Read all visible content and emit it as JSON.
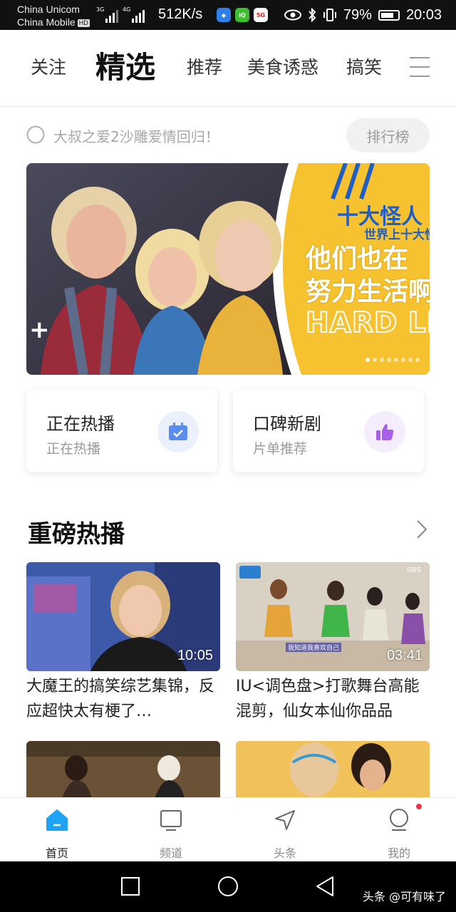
{
  "status_bar": {
    "carrier1": "China Unicom",
    "carrier2": "China Mobile",
    "hd_badge": "HD",
    "net1": "3G",
    "net2": "4G",
    "speed": "512K/s",
    "battery": "79%",
    "time": "20:03",
    "icons": [
      "shield-app-icon",
      "iqiyi-app-icon",
      "5g-app-icon",
      "eye-icon",
      "bluetooth-icon",
      "vibrate-icon",
      "battery-icon"
    ]
  },
  "tabs": [
    "关注",
    "精选",
    "推荐",
    "美食诱惑",
    "搞笑"
  ],
  "active_tab": "精选",
  "search": {
    "placeholder": "大叔之爱2沙雕爱情回归！",
    "rank_label": "排行榜"
  },
  "banner": {
    "line1": "十大怪人",
    "line2": "世界上十大怪人",
    "line3": "他们也在",
    "line4": "努力生活啊",
    "line5": "HARD LIFE",
    "plus": "+",
    "slide_count": 8,
    "active_slide": 1
  },
  "quick_cards": [
    {
      "title": "正在热播",
      "subtitle": "正在热播",
      "icon": "calendar-check-icon",
      "icon_bg": "#eaf1fd",
      "icon_color": "#5b8def"
    },
    {
      "title": "口碑新剧",
      "subtitle": "片单推荐",
      "icon": "thumbs-up-icon",
      "icon_bg": "#f5edfc",
      "icon_color": "#a861e6"
    }
  ],
  "section": {
    "title": "重磅热播"
  },
  "videos": [
    {
      "title": "大魔王的搞笑综艺集锦，反应超快太有梗了…",
      "duration": "10:05"
    },
    {
      "title": "IU<调色盘>打歌舞台高能混剪，仙女本仙你品品",
      "duration": "03:41",
      "subtitle_text": "我知道我喜欢自己",
      "logo": "SBS"
    },
    {
      "title": "",
      "duration": ""
    },
    {
      "title": "",
      "duration": ""
    }
  ],
  "bottom_nav": [
    {
      "label": "首页",
      "icon": "home-icon",
      "active": true
    },
    {
      "label": "频道",
      "icon": "tv-icon",
      "active": false
    },
    {
      "label": "头条",
      "icon": "navigation-arrow-icon",
      "active": false
    },
    {
      "label": "我的",
      "icon": "profile-icon",
      "active": false,
      "badge": true
    }
  ],
  "watermark": "头条 @可有味了",
  "colors": {
    "accent": "#1fa3f5",
    "banner_yellow": "#f6c22f",
    "banner_blue": "#1f5ec4",
    "badge_red": "#e8334a"
  }
}
